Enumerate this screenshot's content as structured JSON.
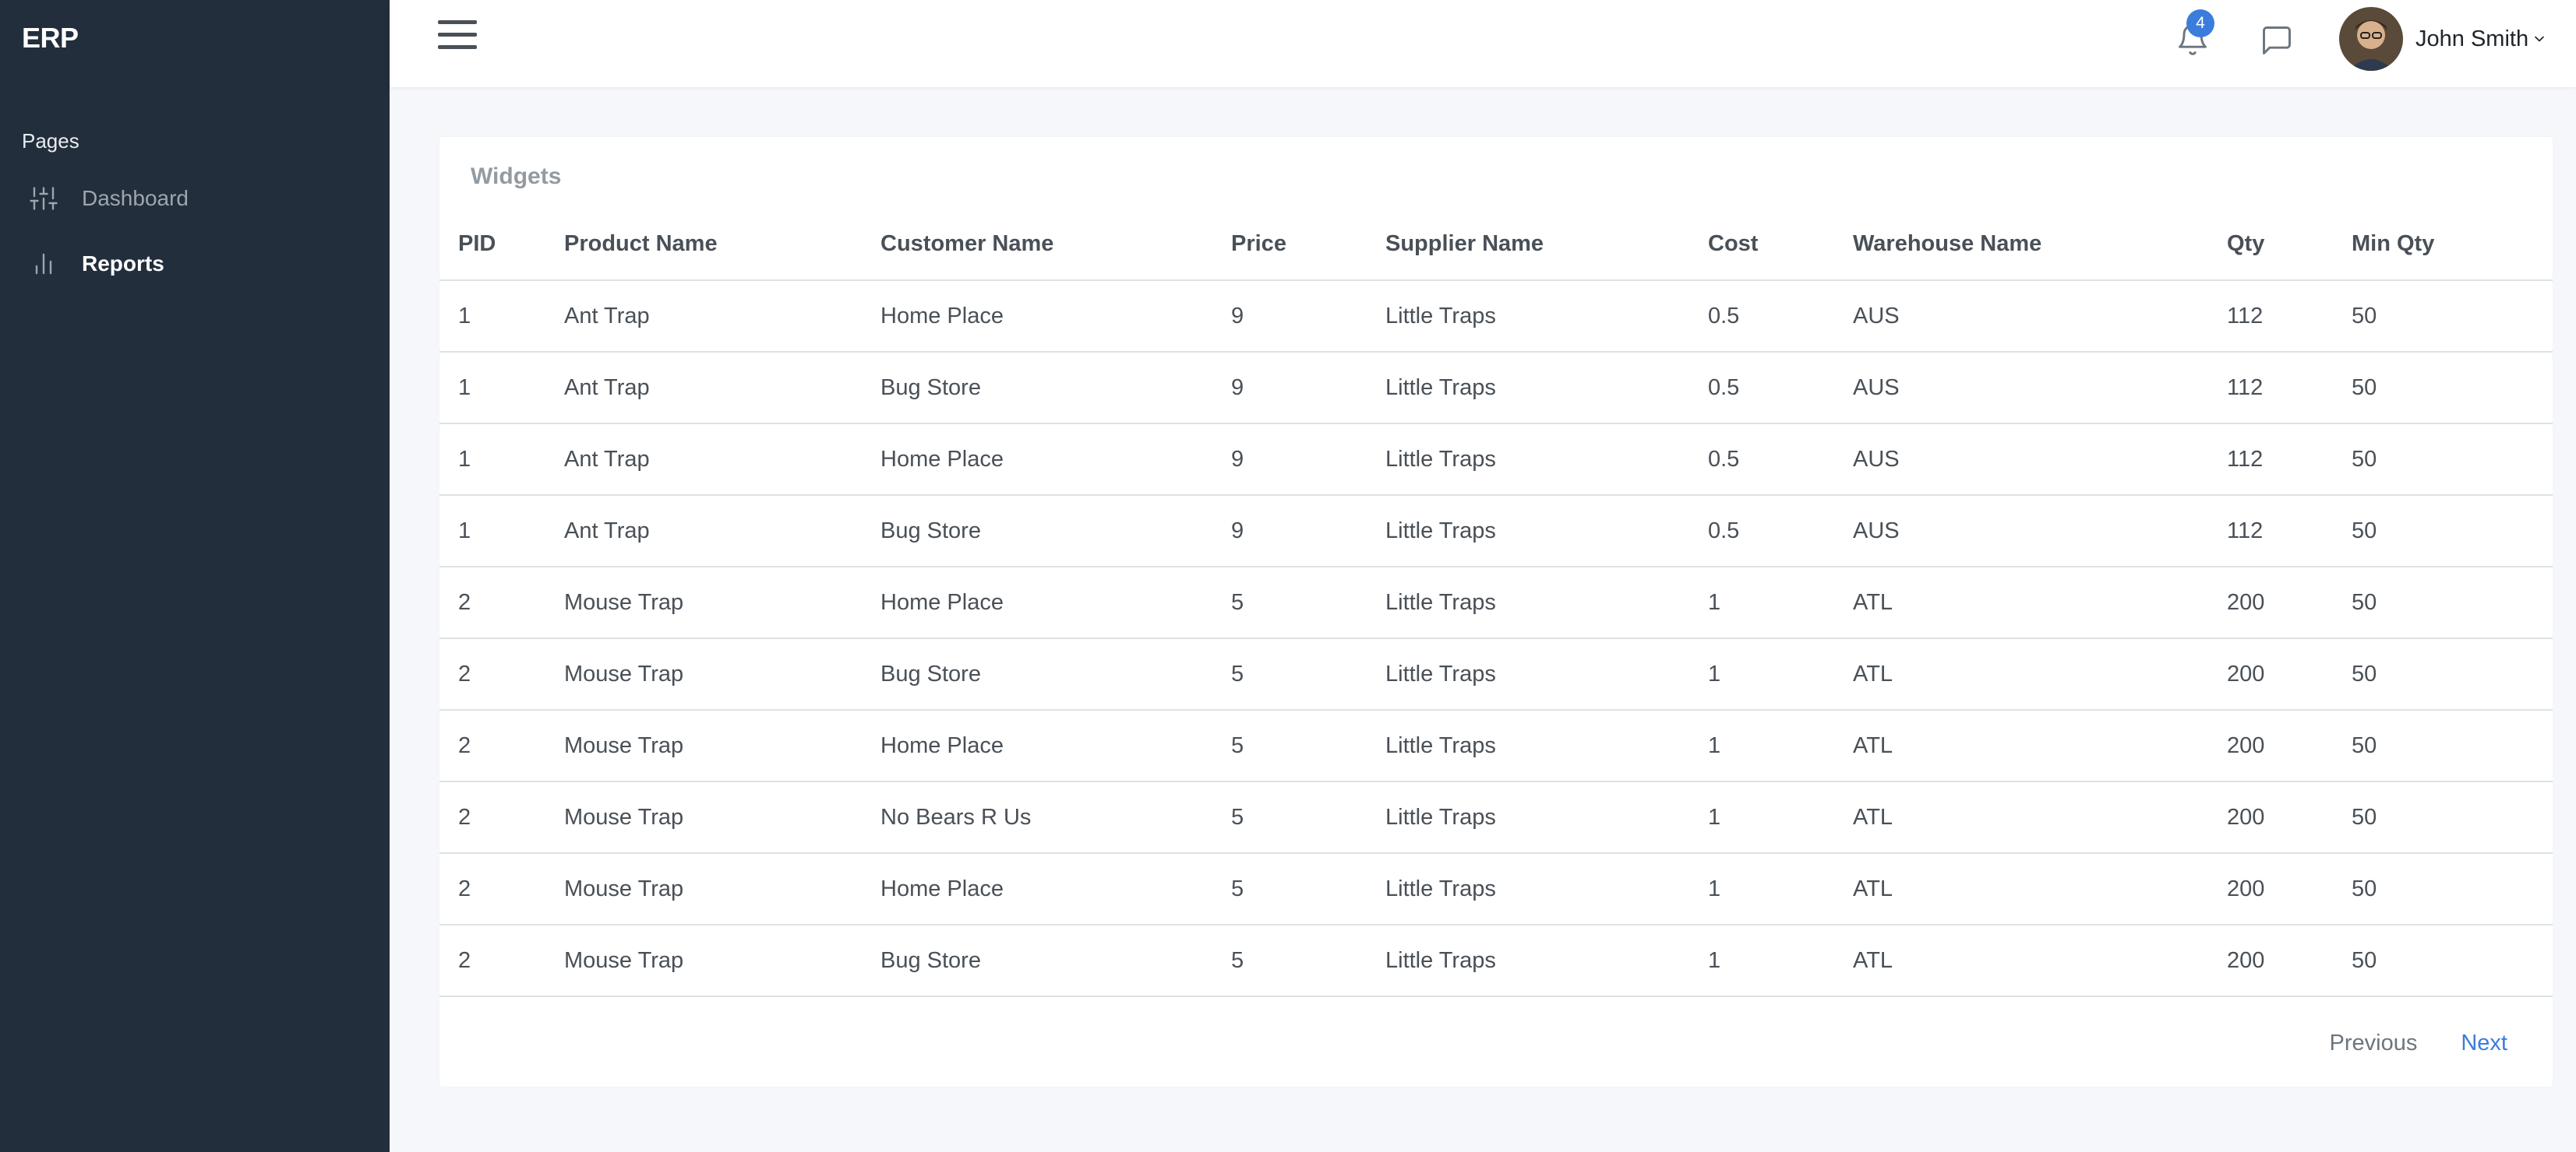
{
  "sidebar": {
    "brand": "ERP",
    "section_header": "Pages",
    "items": [
      {
        "label": "Dashboard",
        "icon": "sliders-icon",
        "active": false
      },
      {
        "label": "Reports",
        "icon": "bar-chart-icon",
        "active": true
      }
    ]
  },
  "topbar": {
    "notification_count": "4",
    "user_name": "John Smith"
  },
  "card": {
    "title": "Widgets",
    "columns": [
      "PID",
      "Product Name",
      "Customer Name",
      "Price",
      "Supplier Name",
      "Cost",
      "Warehouse Name",
      "Qty",
      "Min Qty"
    ],
    "rows": [
      [
        "1",
        "Ant Trap",
        "Home Place",
        "9",
        "Little Traps",
        "0.5",
        "AUS",
        "112",
        "50"
      ],
      [
        "1",
        "Ant Trap",
        "Bug Store",
        "9",
        "Little Traps",
        "0.5",
        "AUS",
        "112",
        "50"
      ],
      [
        "1",
        "Ant Trap",
        "Home Place",
        "9",
        "Little Traps",
        "0.5",
        "AUS",
        "112",
        "50"
      ],
      [
        "1",
        "Ant Trap",
        "Bug Store",
        "9",
        "Little Traps",
        "0.5",
        "AUS",
        "112",
        "50"
      ],
      [
        "2",
        "Mouse Trap",
        "Home Place",
        "5",
        "Little Traps",
        "1",
        "ATL",
        "200",
        "50"
      ],
      [
        "2",
        "Mouse Trap",
        "Bug Store",
        "5",
        "Little Traps",
        "1",
        "ATL",
        "200",
        "50"
      ],
      [
        "2",
        "Mouse Trap",
        "Home Place",
        "5",
        "Little Traps",
        "1",
        "ATL",
        "200",
        "50"
      ],
      [
        "2",
        "Mouse Trap",
        "No Bears R Us",
        "5",
        "Little Traps",
        "1",
        "ATL",
        "200",
        "50"
      ],
      [
        "2",
        "Mouse Trap",
        "Home Place",
        "5",
        "Little Traps",
        "1",
        "ATL",
        "200",
        "50"
      ],
      [
        "2",
        "Mouse Trap",
        "Bug Store",
        "5",
        "Little Traps",
        "1",
        "ATL",
        "200",
        "50"
      ]
    ],
    "pagination": {
      "previous": "Previous",
      "next": "Next"
    }
  },
  "colors": {
    "sidebar_bg": "#222e3c",
    "accent": "#3b7ddd",
    "page_bg": "#f5f7fb"
  }
}
